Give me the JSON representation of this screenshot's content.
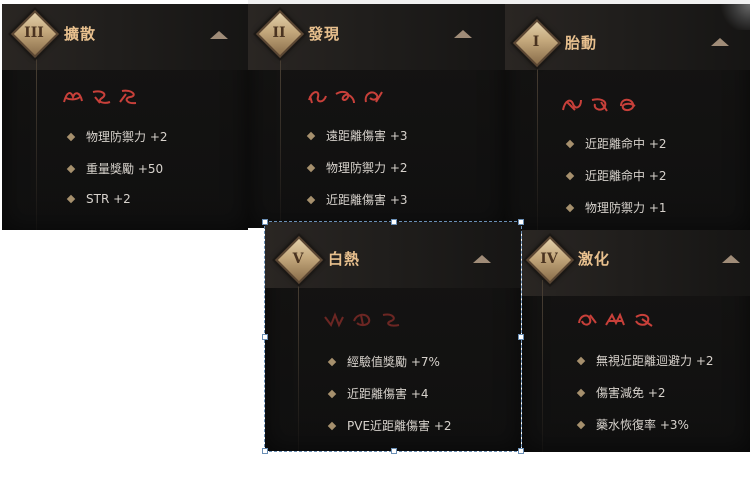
{
  "panels": [
    {
      "numeral": "III",
      "title": "擴散",
      "stats": [
        "物理防禦力 +2",
        "重量獎勵 +50",
        "STR +2"
      ]
    },
    {
      "numeral": "II",
      "title": "發現",
      "stats": [
        "遠距離傷害 +3",
        "物理防禦力 +2",
        "近距離傷害 +3"
      ]
    },
    {
      "numeral": "I",
      "title": "胎動",
      "stats": [
        "近距離命中 +2",
        "近距離命中 +2",
        "物理防禦力 +1"
      ]
    },
    {
      "numeral": "V",
      "title": "白熱",
      "stats": [
        "經驗值獎勵 +7%",
        "近距離傷害 +4",
        "PVE近距離傷害 +2"
      ]
    },
    {
      "numeral": "IV",
      "title": "激化",
      "stats": [
        "無視近距離迴避力 +2",
        "傷害減免 +2",
        "藥水恢復率 +3%"
      ]
    }
  ],
  "colors": {
    "title": "#e8c08e",
    "stat_text": "#d7d2cc",
    "glyph": "#c8403a",
    "badge": "#c3a77b"
  },
  "icons": {
    "badge": "numeral-diamond-badge",
    "collapse": "chevron-up-icon",
    "bullet": "diamond-bullet-icon",
    "glyph": "red-rune-glyph"
  }
}
